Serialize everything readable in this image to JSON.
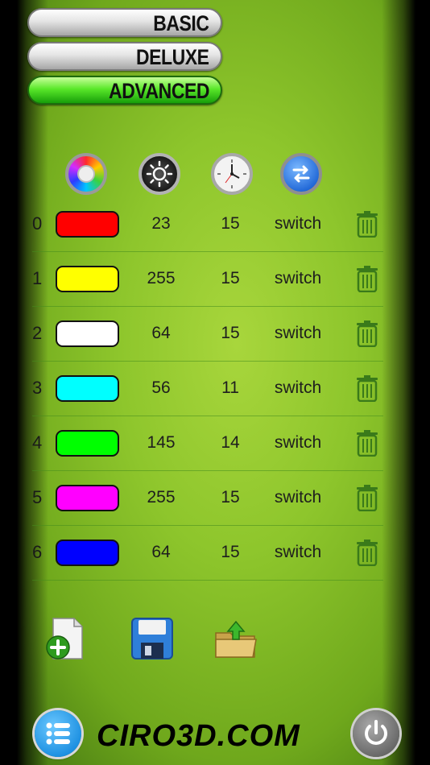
{
  "modes": [
    {
      "label": "BASIC",
      "active": false
    },
    {
      "label": "DELUXE",
      "active": false
    },
    {
      "label": "ADVANCED",
      "active": true
    }
  ],
  "header_icons": [
    "color-wheel-icon",
    "brightness-icon",
    "clock-icon",
    "switch-mode-icon"
  ],
  "rows": [
    {
      "index": "0",
      "color": "#ff0000",
      "brightness": "23",
      "time": "15",
      "mode": "switch"
    },
    {
      "index": "1",
      "color": "#ffff00",
      "brightness": "255",
      "time": "15",
      "mode": "switch"
    },
    {
      "index": "2",
      "color": "#ffffff",
      "brightness": "64",
      "time": "15",
      "mode": "switch"
    },
    {
      "index": "3",
      "color": "#00ffff",
      "brightness": "56",
      "time": "11",
      "mode": "switch"
    },
    {
      "index": "4",
      "color": "#00ff00",
      "brightness": "145",
      "time": "14",
      "mode": "switch"
    },
    {
      "index": "5",
      "color": "#ff00ff",
      "brightness": "255",
      "time": "15",
      "mode": "switch"
    },
    {
      "index": "6",
      "color": "#0000ff",
      "brightness": "64",
      "time": "15",
      "mode": "switch"
    }
  ],
  "tools": [
    "new-file-icon",
    "save-disk-icon",
    "open-folder-icon"
  ],
  "footer": {
    "logo": "CIRO3D.COM"
  }
}
